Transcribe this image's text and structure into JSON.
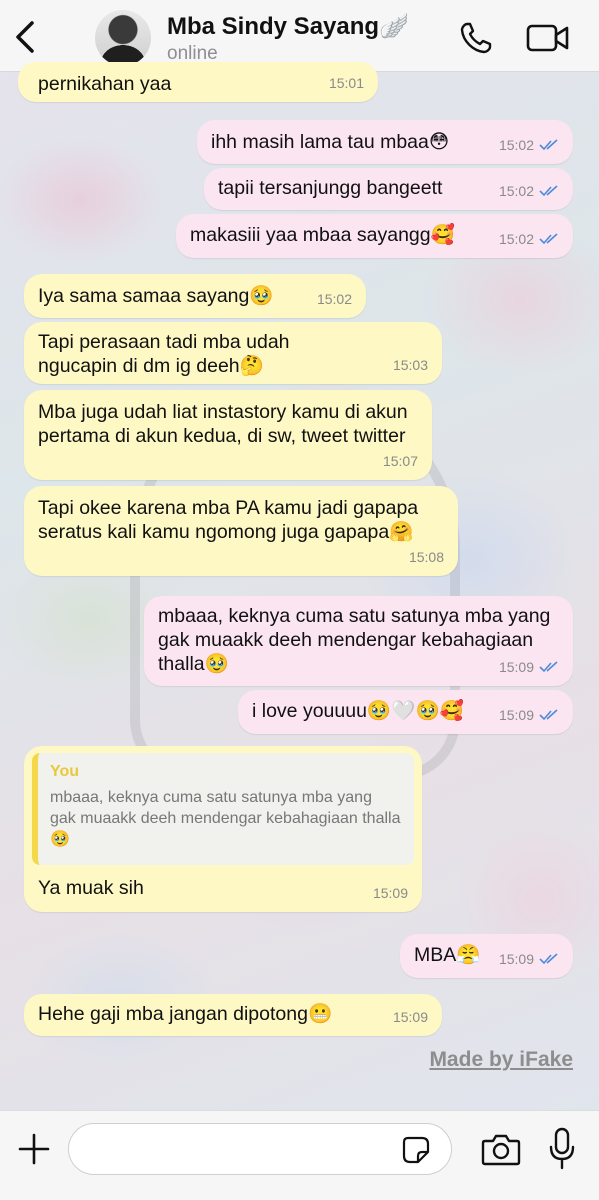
{
  "header": {
    "contact_name": "Mba Sindy Sayang🪽",
    "status": "online"
  },
  "messages": [
    {
      "dir": "in",
      "text": "pernikahan yaa",
      "time": "15:01"
    },
    {
      "dir": "out",
      "text": "ihh masih lama tau mbaa😳",
      "time": "15:02",
      "read": true
    },
    {
      "dir": "out",
      "text": "tapii tersanjungg bangeett",
      "time": "15:02",
      "read": true
    },
    {
      "dir": "out",
      "text": "makasiii yaa mbaa sayangg🥰",
      "time": "15:02",
      "read": true
    },
    {
      "dir": "in",
      "text": "Iya sama samaa sayang🥹",
      "time": "15:02"
    },
    {
      "dir": "in",
      "text": "Tapi perasaan tadi mba udah ngucapin di dm ig deeh🤔",
      "time": "15:03"
    },
    {
      "dir": "in",
      "text": "Mba juga udah liat instastory kamu di akun pertama di akun kedua, di sw, tweet twitter",
      "time": "15:07"
    },
    {
      "dir": "in",
      "text": "Tapi okee karena mba PA kamu jadi gapapa seratus kali kamu ngomong juga gapapa🤗",
      "time": "15:08"
    },
    {
      "dir": "out",
      "text": "mbaaa, keknya cuma satu satunya mba yang gak muaakk deeh mendengar kebahagiaan thalla🥹",
      "time": "15:09",
      "read": true
    },
    {
      "dir": "out",
      "text": "i love youuuu🥹🤍🥹🥰",
      "time": "15:09",
      "read": true
    },
    {
      "dir": "in",
      "reply_author": "You",
      "reply_text": "mbaaa, keknya cuma satu satunya mba yang gak muaakk deeh mendengar kebahagiaan thalla🥹",
      "text": "Ya muak sih",
      "time": "15:09"
    },
    {
      "dir": "out",
      "text": "MBA😤",
      "time": "15:09",
      "read": true
    },
    {
      "dir": "in",
      "text": "Hehe gaji mba jangan dipotong😬",
      "time": "15:09"
    }
  ],
  "watermark": "Made by iFake",
  "composer": {
    "value": "",
    "placeholder": ""
  },
  "colors": {
    "incoming_bubble": "#fdf8c4",
    "outgoing_bubble": "#fbe5f1",
    "read_ticks": "#4f8bd8",
    "reply_accent": "#f5d84a"
  }
}
